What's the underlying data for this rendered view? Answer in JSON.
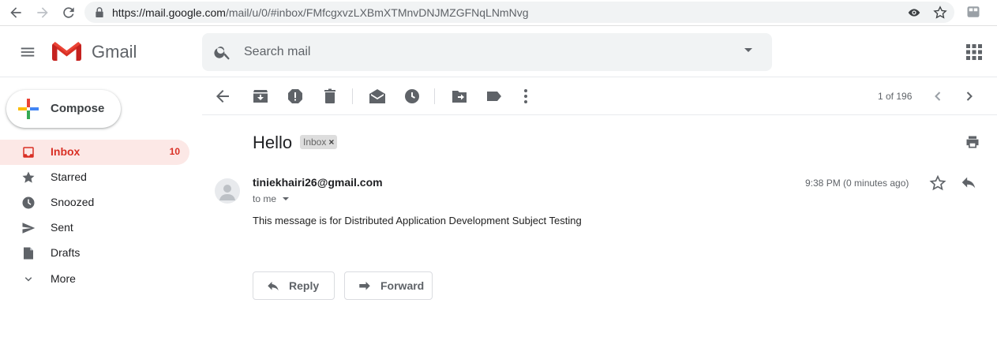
{
  "browser": {
    "url_host": "https://mail.google.com",
    "url_path": "/mail/u/0/#inbox/FMfcgxvzLXBmXTMnvDNJMZGFNqLNmNvg"
  },
  "header": {
    "app_name": "Gmail",
    "search_placeholder": "Search mail"
  },
  "sidebar": {
    "compose_label": "Compose",
    "items": [
      {
        "label": "Inbox",
        "count": "10",
        "icon": "inbox-icon"
      },
      {
        "label": "Starred",
        "icon": "star-icon"
      },
      {
        "label": "Snoozed",
        "icon": "clock-icon"
      },
      {
        "label": "Sent",
        "icon": "send-icon"
      },
      {
        "label": "Drafts",
        "icon": "draft-icon"
      },
      {
        "label": "More",
        "icon": "chevron-down-icon"
      }
    ]
  },
  "toolbar": {
    "pager": "1 of 196"
  },
  "message": {
    "subject": "Hello",
    "label": "Inbox",
    "sender": "tiniekhairi26@gmail.com",
    "recipient_line": "to me",
    "time": "9:38 PM (0 minutes ago)",
    "body": "This message is for Distributed Application Development Subject Testing",
    "reply_label": "Reply",
    "forward_label": "Forward"
  },
  "colors": {
    "accent_red": "#d93025",
    "active_bg": "#fce8e6",
    "icon_gray": "#5f6368"
  }
}
